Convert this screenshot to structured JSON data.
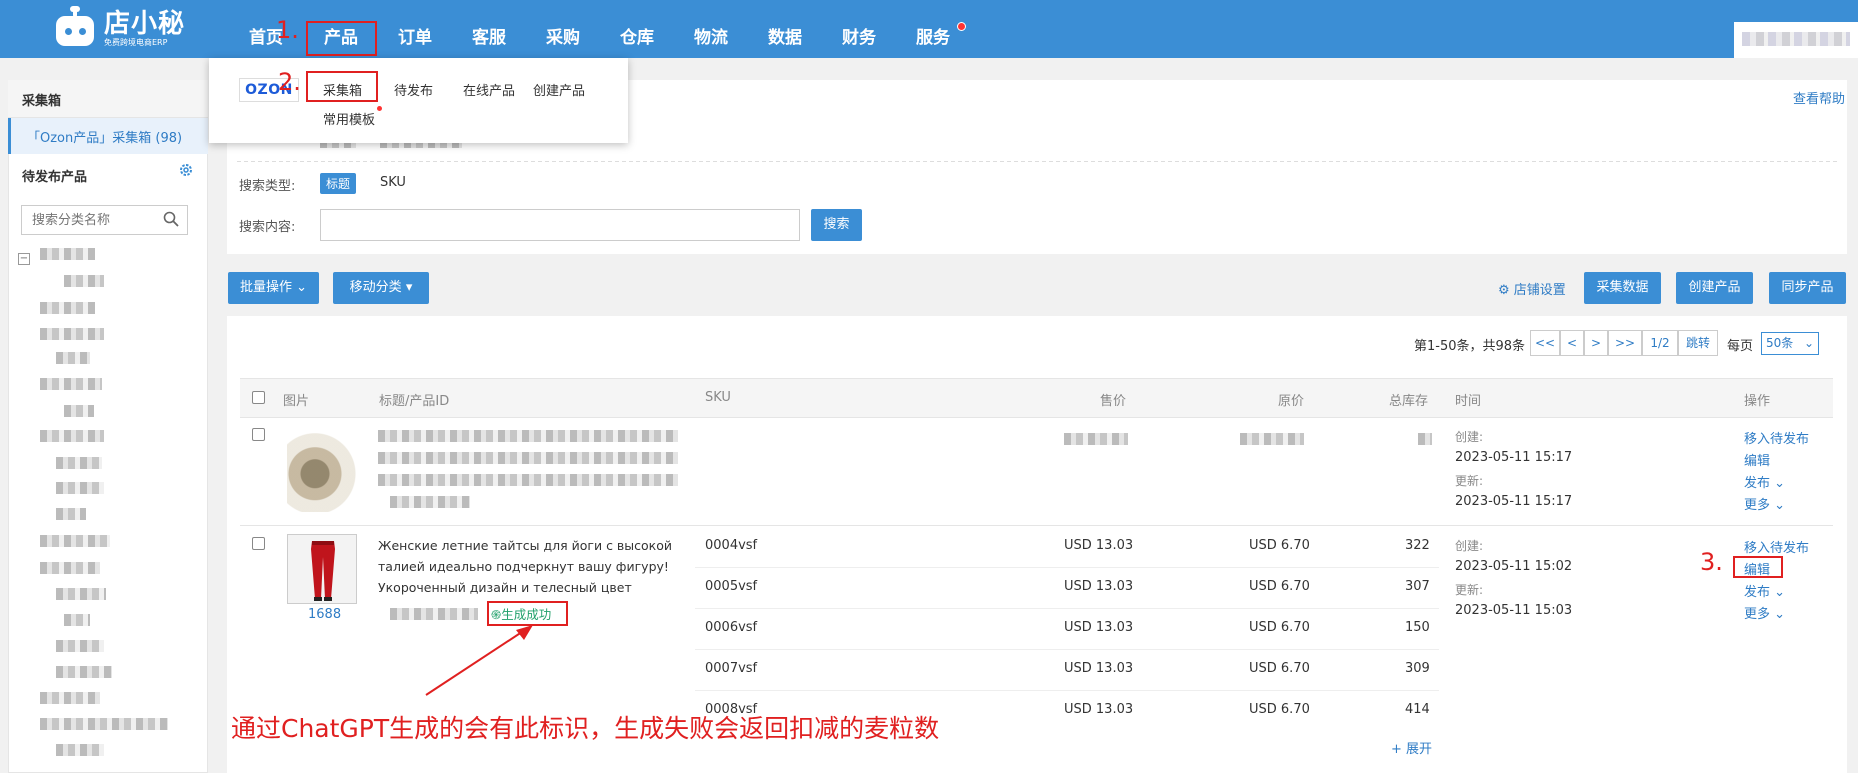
{
  "brand": {
    "name": "店小秘",
    "tagline": "免费跨境电商ERP"
  },
  "nav": {
    "items": [
      "首页",
      "产品",
      "订单",
      "客服",
      "采购",
      "仓库",
      "物流",
      "数据",
      "财务",
      "服务"
    ]
  },
  "dropdown": {
    "platform_logo": "OZON",
    "items": [
      "采集箱",
      "待发布",
      "在线产品",
      "创建产品",
      "常用模板"
    ]
  },
  "annotations": {
    "step1": "1.",
    "step2": "2.",
    "step3": "3.",
    "note": "通过ChatGPT生成的会有此标识，生成失败会返回扣减的麦粒数"
  },
  "sidebar": {
    "collect_title": "采集箱",
    "collect_item": "「Ozon产品」采集箱 (98)",
    "pending_title": "待发布产品",
    "search_placeholder": "搜索分类名称"
  },
  "filter": {
    "help_link": "查看帮助",
    "search_type_label": "搜索类型:",
    "search_type_options": [
      "标题",
      "SKU"
    ],
    "search_content_label": "搜索内容:",
    "search_button": "搜索"
  },
  "toolbar": {
    "batch": "批量操作",
    "move": "移动分类",
    "shop_settings": "店铺设置",
    "collect_data": "采集数据",
    "create_product": "创建产品",
    "sync_product": "同步产品"
  },
  "pager": {
    "summary": "第1-50条，共98条",
    "buttons": [
      "<<",
      "<",
      ">",
      ">>",
      "1/2",
      "跳转"
    ],
    "per_page_label": "每页",
    "per_page_value": "50条"
  },
  "table": {
    "headers": [
      "图片",
      "标题/产品ID",
      "SKU",
      "售价",
      "原价",
      "总库存",
      "时间",
      "操作"
    ],
    "row1": {
      "created_label": "创建:",
      "created": "2023-05-11 15:17",
      "updated_label": "更新:",
      "updated": "2023-05-11 15:17",
      "ops": [
        "移入待发布",
        "编辑",
        "发布",
        "更多"
      ]
    },
    "row2": {
      "source": "1688",
      "title": "Женские летние тайтсы для йоги с высокой талией идеально подчеркнут вашу фигуру! Укороченный дизайн и телесный цвет подходят для тренировок",
      "badge": "生成成功",
      "skus": [
        {
          "sku": "0004vsf",
          "price": "USD 13.03",
          "orig": "USD 6.70",
          "stock": "322"
        },
        {
          "sku": "0005vsf",
          "price": "USD 13.03",
          "orig": "USD 6.70",
          "stock": "307"
        },
        {
          "sku": "0006vsf",
          "price": "USD 13.03",
          "orig": "USD 6.70",
          "stock": "150"
        },
        {
          "sku": "0007vsf",
          "price": "USD 13.03",
          "orig": "USD 6.70",
          "stock": "309"
        },
        {
          "sku": "0008vsf",
          "price": "USD 13.03",
          "orig": "USD 6.70",
          "stock": "414"
        }
      ],
      "expand": "+ 展开",
      "created_label": "创建:",
      "created": "2023-05-11 15:02",
      "updated_label": "更新:",
      "updated": "2023-05-11 15:03",
      "ops": [
        "移入待发布",
        "编辑",
        "发布",
        "更多"
      ]
    }
  },
  "colors": {
    "primary": "#3b8ed5",
    "annotation": "#e02020",
    "success": "#22a06b"
  }
}
